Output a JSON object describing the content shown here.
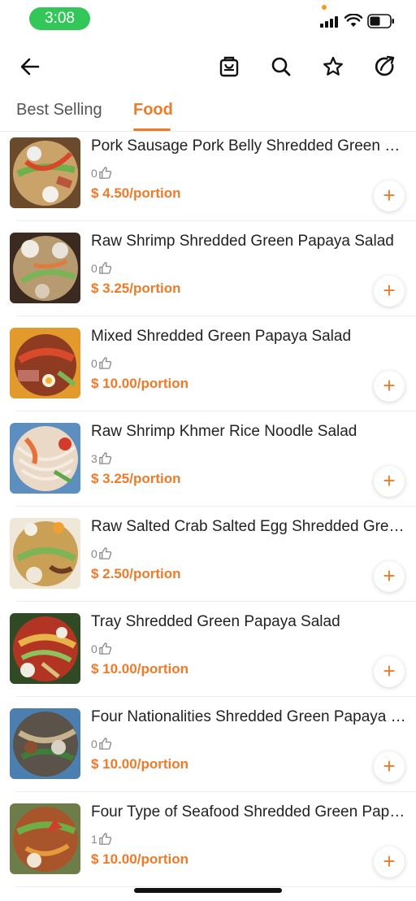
{
  "status": {
    "time": "3:08",
    "colors": {
      "time_pill": "#33c759",
      "indicator_dot": "#f39a1f"
    },
    "icons": [
      "cellular-signal-icon",
      "wifi-icon",
      "battery-icon"
    ]
  },
  "nav": {
    "icons": [
      "back-arrow-icon",
      "shopping-bag-icon",
      "search-icon",
      "star-icon",
      "share-icon"
    ]
  },
  "tabs": [
    {
      "label": "Best Selling",
      "active": false
    },
    {
      "label": "Food",
      "active": true
    }
  ],
  "colors": {
    "accent": "#ef7a28"
  },
  "items": [
    {
      "name": "Pork Sausage Pork Belly Shredded Green Papaya Salad",
      "likes": "0",
      "price": "$ 4.50/portion",
      "add": "+"
    },
    {
      "name": "Raw Shrimp Shredded Green Papaya Salad",
      "likes": "0",
      "price": "$ 3.25/portion",
      "add": "+"
    },
    {
      "name": "Mixed Shredded Green Papaya Salad",
      "likes": "0",
      "price": "$ 10.00/portion",
      "add": "+"
    },
    {
      "name": "Raw Shrimp Khmer Rice Noodle Salad",
      "likes": "3",
      "price": "$ 3.25/portion",
      "add": "+"
    },
    {
      "name": "Raw Salted Crab Salted Egg Shredded Green Papaya Salad",
      "likes": "0",
      "price": "$ 2.50/portion",
      "add": "+"
    },
    {
      "name": "Tray Shredded Green Papaya Salad",
      "likes": "0",
      "price": "$ 10.00/portion",
      "add": "+"
    },
    {
      "name": "Four Nationalities Shredded Green Papaya Salad",
      "likes": "0",
      "price": "$ 10.00/portion",
      "add": "+"
    },
    {
      "name": "Four Type of Seafood Shredded Green Papaya Salad",
      "likes": "1",
      "price": "$ 10.00/portion",
      "add": "+"
    }
  ]
}
